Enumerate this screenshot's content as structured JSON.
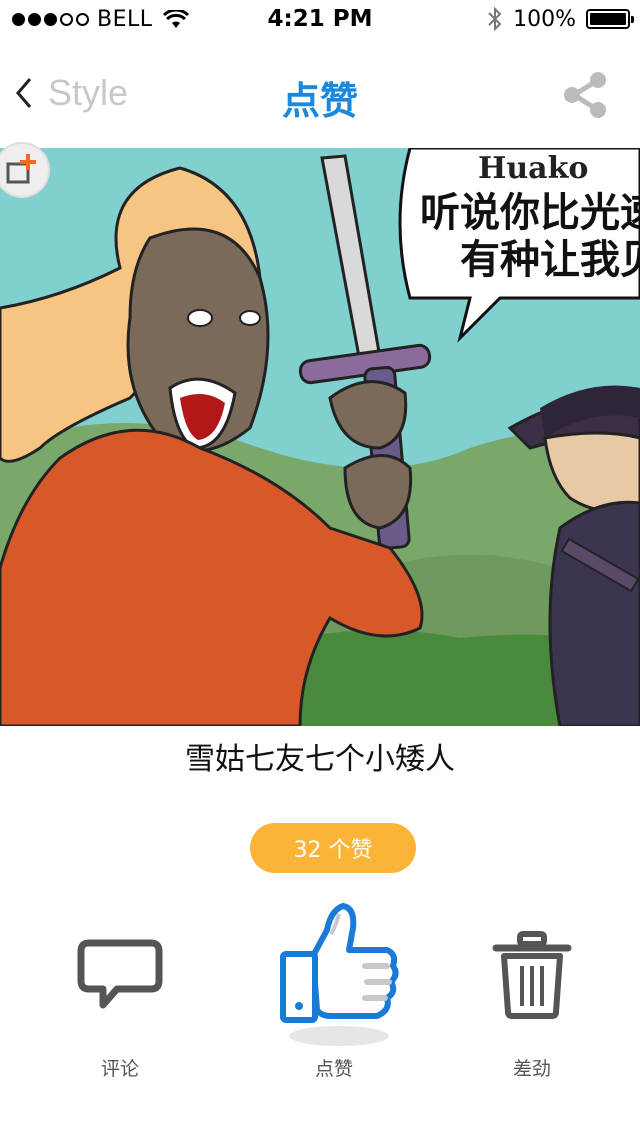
{
  "status_bar": {
    "carrier": "BELL",
    "time": "4:21 PM",
    "battery": "100%"
  },
  "nav": {
    "back_label": "Style",
    "title": "点赞"
  },
  "comic": {
    "speech_line_1": "听说你比光速",
    "speech_line_2": "有种让我见",
    "watermark": "Huako"
  },
  "caption": "雪姑七友七个小矮人",
  "likes": {
    "text": "32 个赞",
    "count": 32
  },
  "actions": {
    "comment_label": "评论",
    "like_label": "点赞",
    "dislike_label": "差劲"
  },
  "colors": {
    "accent_blue": "#1a88dd",
    "badge_orange": "#fbb437",
    "icon_gray": "#555555"
  }
}
